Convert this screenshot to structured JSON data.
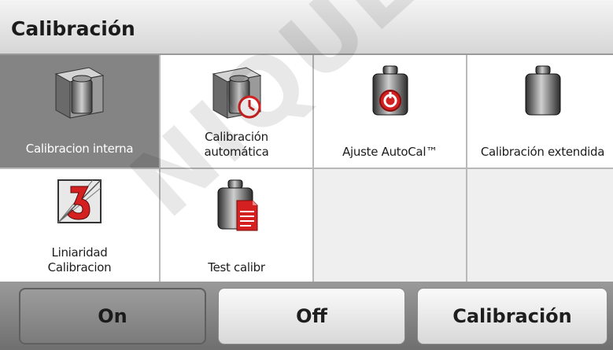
{
  "header": {
    "title": "Calibración"
  },
  "tiles": [
    {
      "label": "Calibracion interna",
      "icon": "internal-weight-icon",
      "selected": true
    },
    {
      "label_line1": "Calibración",
      "label_line2": "automática",
      "icon": "auto-calibration-icon"
    },
    {
      "label": "Ajuste AutoCal™",
      "icon": "autocal-adjust-icon"
    },
    {
      "label": "Calibración extendida",
      "icon": "extended-calibration-icon"
    },
    {
      "label_line1": "Liniaridad",
      "label_line2": "Calibracion",
      "icon": "linearity-calibration-icon"
    },
    {
      "label": "Test calibr",
      "icon": "calibration-test-icon"
    }
  ],
  "buttons": {
    "on": "On",
    "off": "Off",
    "calibration": "Calibración"
  },
  "watermark": "NIQUE DU",
  "colors": {
    "selected_tile": "#848484",
    "accent_red": "#d42020",
    "bar_gray": "#7f7f7f"
  }
}
